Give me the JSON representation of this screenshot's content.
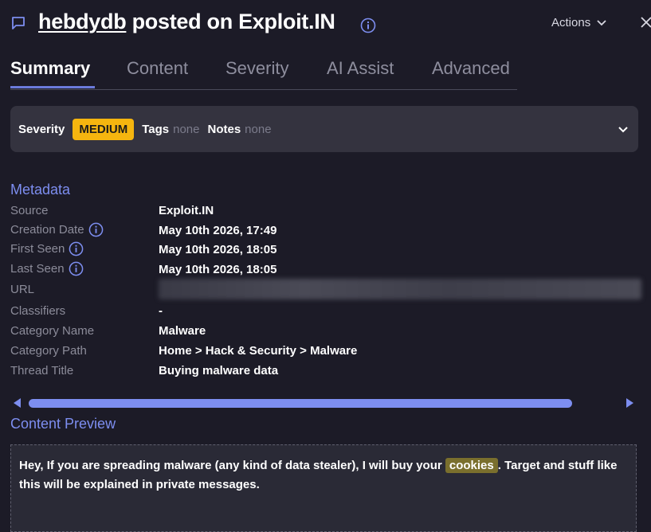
{
  "header": {
    "username": "hebdydb",
    "title_suffix": " posted on Exploit.IN",
    "actions_label": "Actions"
  },
  "tabs": [
    {
      "label": "Summary",
      "active": true
    },
    {
      "label": "Content",
      "active": false
    },
    {
      "label": "Severity",
      "active": false
    },
    {
      "label": "AI Assist",
      "active": false
    },
    {
      "label": "Advanced",
      "active": false
    }
  ],
  "severity_bar": {
    "severity_label": "Severity",
    "severity_value": "MEDIUM",
    "tags_label": "Tags",
    "tags_value": "none",
    "notes_label": "Notes",
    "notes_value": "none"
  },
  "metadata": {
    "title": "Metadata",
    "rows": [
      {
        "label": "Source",
        "value": "Exploit.IN"
      },
      {
        "label": "Creation Date",
        "value": "May 10th 2026, 17:49"
      },
      {
        "label": "First Seen",
        "value": "May 10th 2026, 18:05"
      },
      {
        "label": "Last Seen",
        "value": "May 10th 2026, 18:05"
      },
      {
        "label": "URL",
        "value": ""
      },
      {
        "label": "Classifiers",
        "value": "-"
      },
      {
        "label": "Category Name",
        "value": "Malware"
      },
      {
        "label": "Category Path",
        "value": "Home > Hack & Security > Malware"
      },
      {
        "label": "Thread Title",
        "value": "Buying malware data"
      }
    ]
  },
  "content_preview": {
    "title": "Content Preview",
    "text_before": "Hey, If you are spreading malware (any kind of data stealer), I will buy your ",
    "highlight": "cookies",
    "text_after": ". Target and stuff like this will be explained in private messages."
  },
  "colors": {
    "background": "#1c1b27",
    "accent": "#7d8ef0",
    "severity_medium": "#f5b50f",
    "highlight": "#7a6f2d"
  }
}
